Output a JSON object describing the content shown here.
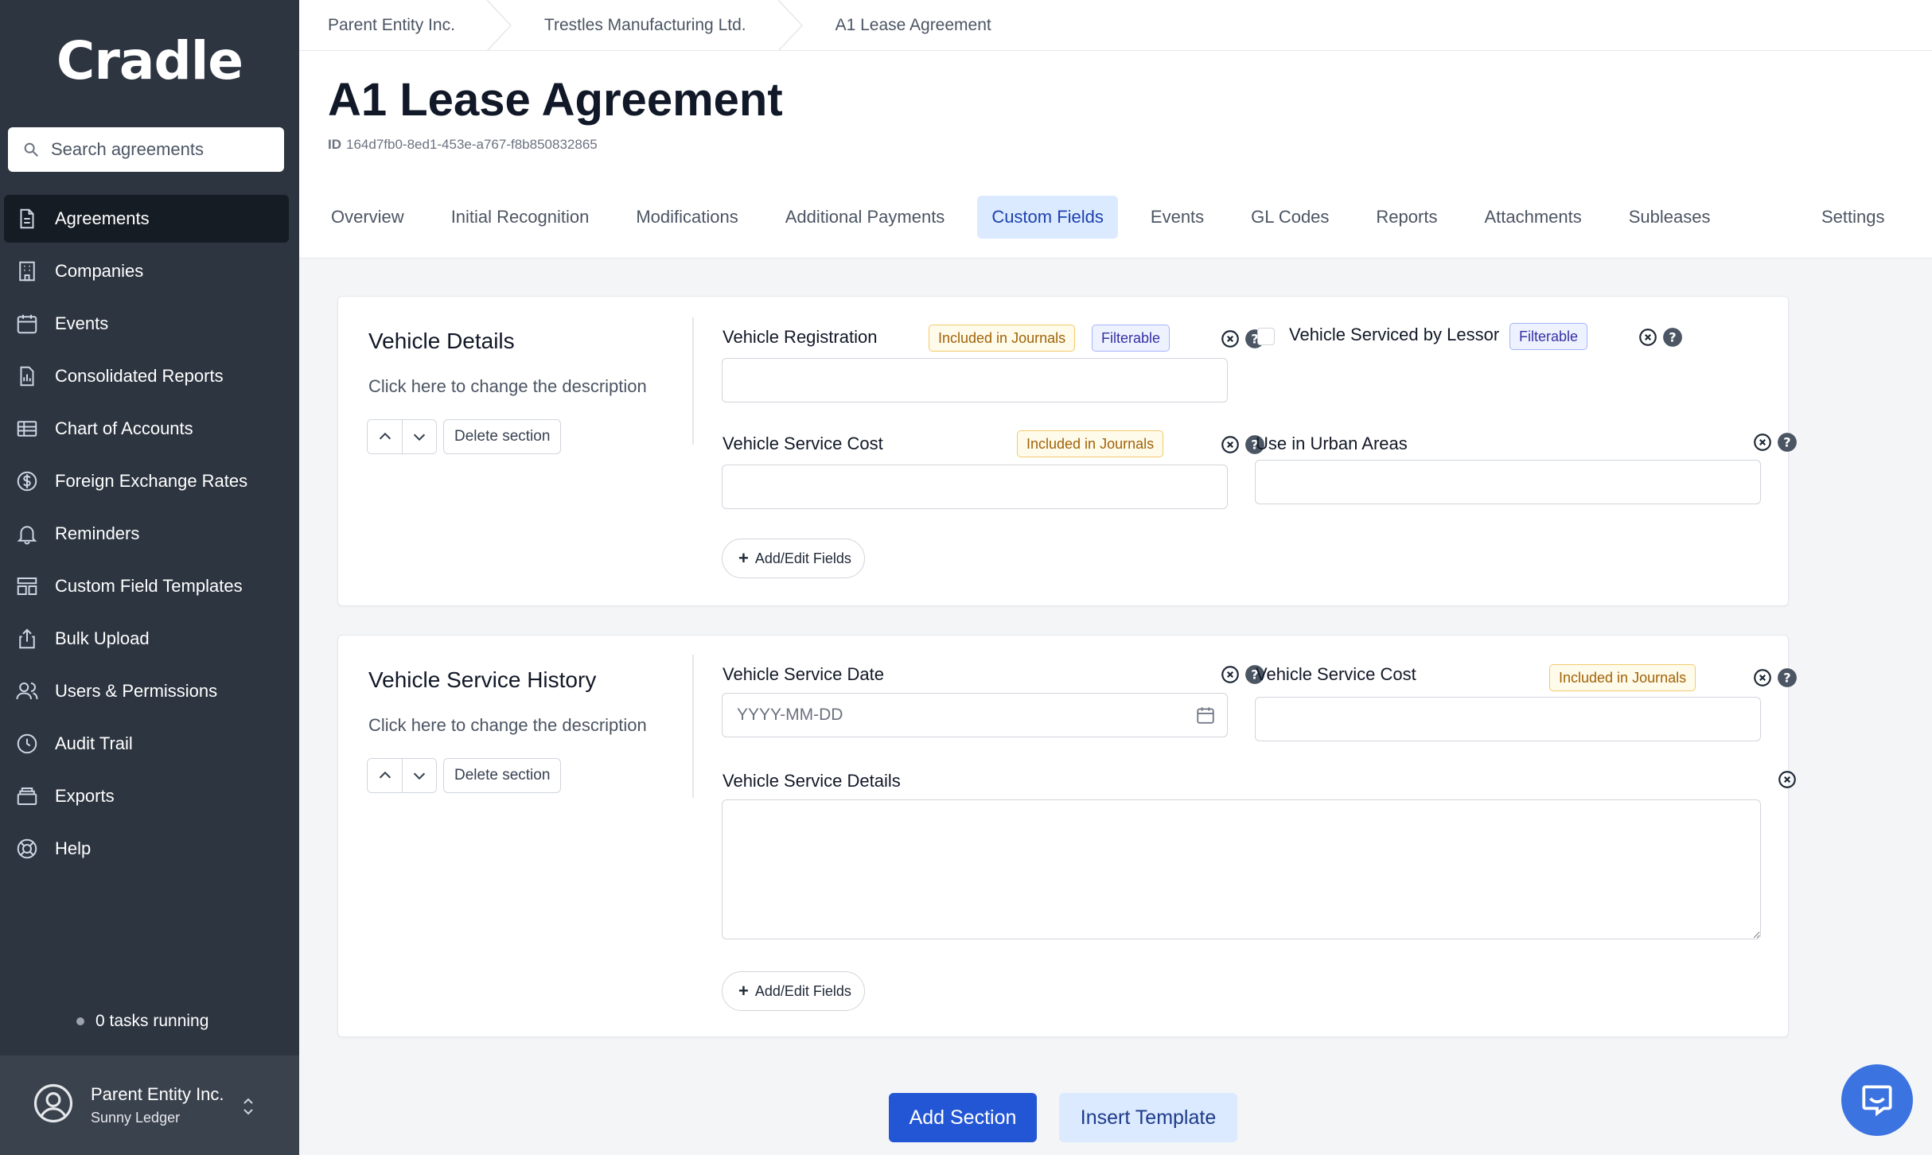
{
  "app": {
    "logo": "Cradle"
  },
  "search": {
    "placeholder": "Search agreements"
  },
  "nav": {
    "items": [
      {
        "label": "Agreements",
        "icon": "document-icon",
        "active": true
      },
      {
        "label": "Companies",
        "icon": "building-icon"
      },
      {
        "label": "Events",
        "icon": "calendar-icon"
      },
      {
        "label": "Consolidated Reports",
        "icon": "report-icon"
      },
      {
        "label": "Chart of Accounts",
        "icon": "table-icon"
      },
      {
        "label": "Foreign Exchange Rates",
        "icon": "dollar-icon"
      },
      {
        "label": "Reminders",
        "icon": "bell-icon"
      },
      {
        "label": "Custom Field Templates",
        "icon": "template-icon"
      },
      {
        "label": "Bulk Upload",
        "icon": "upload-icon"
      },
      {
        "label": "Users & Permissions",
        "icon": "users-icon"
      },
      {
        "label": "Audit Trail",
        "icon": "clock-icon"
      },
      {
        "label": "Exports",
        "icon": "archive-icon"
      },
      {
        "label": "Help",
        "icon": "lifebuoy-icon"
      }
    ]
  },
  "tasks": {
    "label": "0 tasks running"
  },
  "user": {
    "name": "Parent Entity Inc.",
    "sub": "Sunny Ledger"
  },
  "breadcrumb": [
    "Parent Entity Inc.",
    "Trestles Manufacturing Ltd.",
    "A1 Lease Agreement"
  ],
  "page": {
    "title": "A1 Lease Agreement",
    "id_label": "ID",
    "id_value": "164d7fb0-8ed1-453e-a767-f8b850832865"
  },
  "tabs": [
    {
      "label": "Overview"
    },
    {
      "label": "Initial Recognition"
    },
    {
      "label": "Modifications"
    },
    {
      "label": "Additional Payments"
    },
    {
      "label": "Custom Fields",
      "active": true
    },
    {
      "label": "Events"
    },
    {
      "label": "GL Codes"
    },
    {
      "label": "Reports"
    },
    {
      "label": "Attachments"
    },
    {
      "label": "Subleases"
    }
  ],
  "settings_tab": "Settings",
  "badges": {
    "journal": "Included in Journals",
    "filter": "Filterable"
  },
  "section_controls": {
    "delete": "Delete section",
    "add_edit": "Add/Edit Fields"
  },
  "sections": [
    {
      "title": "Vehicle Details",
      "description": "Click here to change the description",
      "fields": {
        "registration": "Vehicle Registration",
        "serviced": "Vehicle Serviced by Lessor",
        "cost": "Vehicle Service Cost",
        "urban": "Use in Urban Areas"
      }
    },
    {
      "title": "Vehicle Service History",
      "description": "Click here to change the description",
      "fields": {
        "date": "Vehicle Service Date",
        "date_placeholder": "YYYY-MM-DD",
        "cost": "Vehicle Service Cost",
        "details": "Vehicle Service Details"
      }
    }
  ],
  "actions": {
    "add_section": "Add Section",
    "insert_template": "Insert Template"
  },
  "colors": {
    "sidebar": "#2d3540",
    "primary": "#2356d4",
    "active_tab": "#dbeafe"
  }
}
